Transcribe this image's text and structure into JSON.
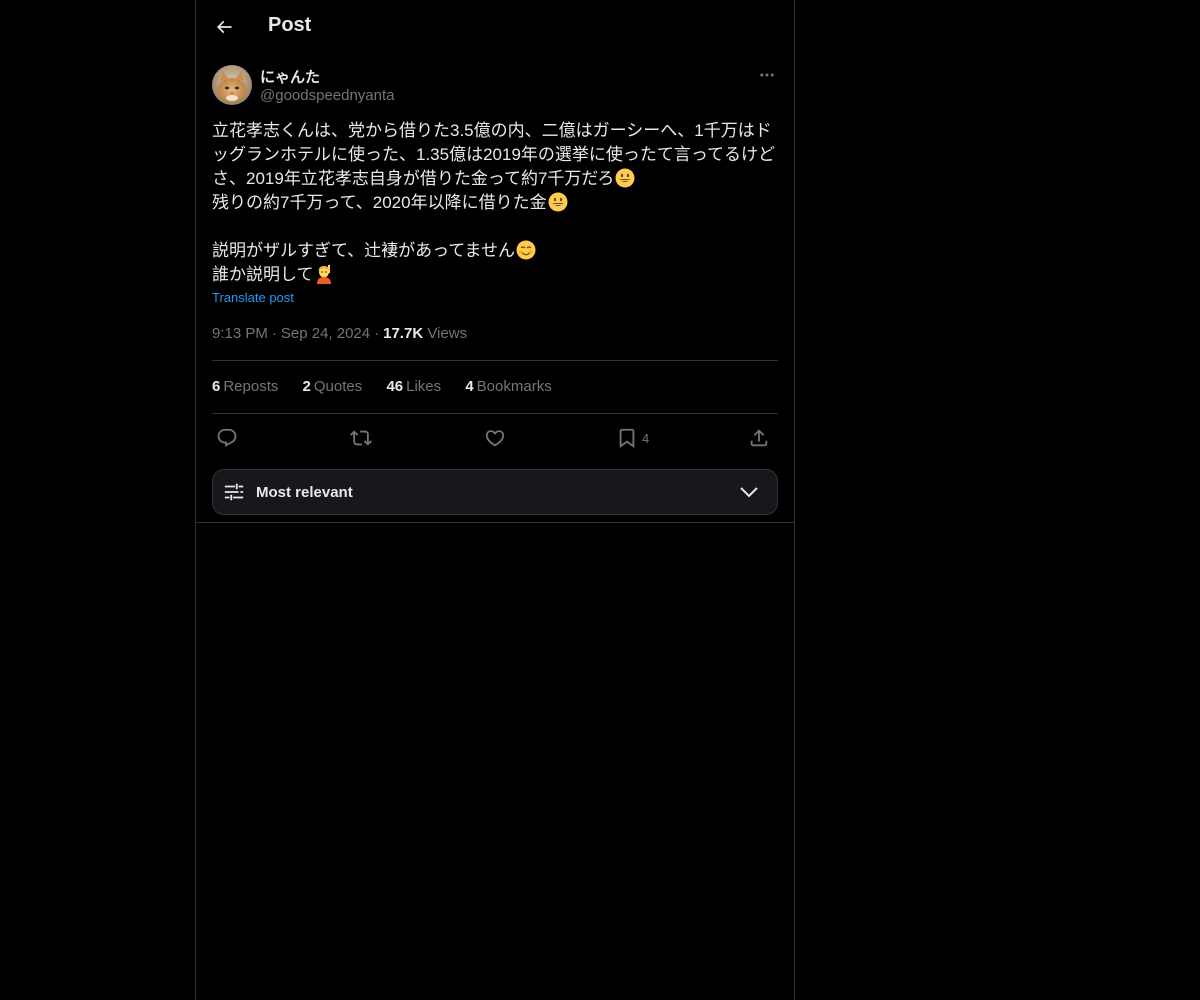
{
  "header": {
    "title": "Post",
    "back_icon": "arrow-left-icon"
  },
  "author": {
    "display_name": "にゃんた",
    "handle": "@goodspeednyanta",
    "more_icon": "more-horizontal-icon"
  },
  "tweet": {
    "lines": [
      "立花孝志くんは、党から借りた3.5億の内、二億はガーシーへ、1千万はド",
      "ッグランホテルに使った、1.35億は2019年の選挙に使ったて言ってるけど",
      "さ、2019年立花孝志自身が借りた金って約7千万だろ",
      "残りの約7千万って、2020年以降に借りた金",
      "",
      "説明がザルすぎて、辻褄があってません",
      "誰か説明して"
    ],
    "translate_label": "Translate post"
  },
  "meta": {
    "time": "9:13 PM",
    "date": "Sep 24, 2024",
    "views_count": "17.7K",
    "views_label": "Views"
  },
  "stats": {
    "reposts_count": "6",
    "reposts_label": "Reposts",
    "quotes_count": "2",
    "quotes_label": "Quotes",
    "likes_count": "46",
    "likes_label": "Likes",
    "bookmarks_count": "4",
    "bookmarks_label": "Bookmarks"
  },
  "actions": {
    "reply_icon": "reply-icon",
    "repost_icon": "repost-icon",
    "like_icon": "heart-icon",
    "bookmark_icon": "bookmark-icon",
    "bookmark_count": "4",
    "share_icon": "share-icon"
  },
  "sort": {
    "label": "Most relevant",
    "icon": "sliders-icon",
    "chevron": "chevron-down-icon"
  },
  "colors": {
    "background": "#000000",
    "text": "#e7e9ea",
    "muted": "#71767b",
    "link": "#1d9bf0",
    "border": "#2f3336"
  }
}
